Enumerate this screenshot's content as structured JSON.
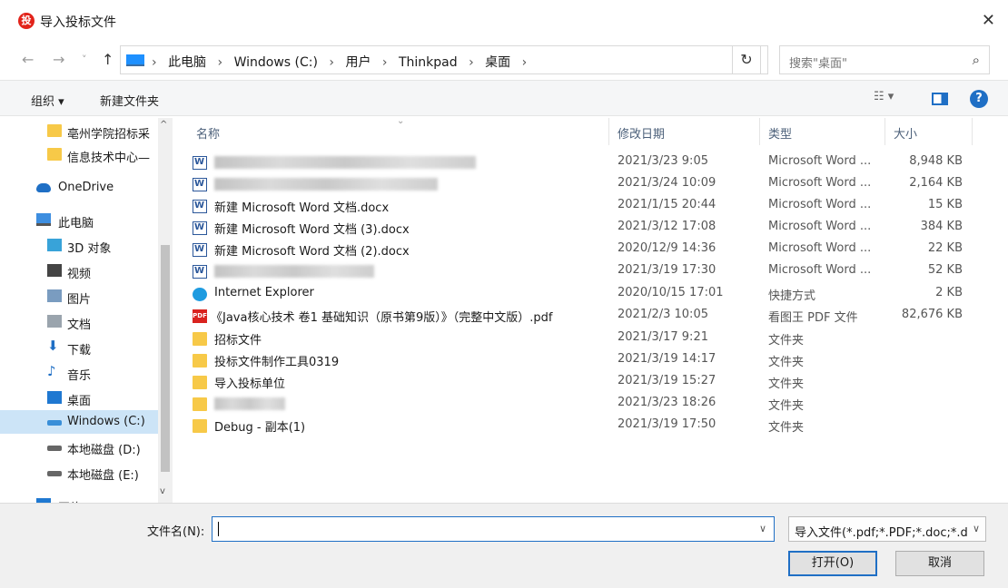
{
  "window": {
    "title": "导入投标文件",
    "app_icon": "app-logo-icon",
    "close": "✕"
  },
  "nav": {
    "back": "←",
    "forward": "→",
    "recent": "˅",
    "up": "↑",
    "breadcrumbs": [
      "此电脑",
      "Windows (C:)",
      "用户",
      "Thinkpad",
      "桌面"
    ],
    "separator": "›",
    "refresh": "↻",
    "search_placeholder": "搜索\"桌面\"",
    "search_icon": "⌕"
  },
  "toolbar": {
    "organize": "组织 ▾",
    "new_folder": "新建文件夹",
    "help": "?"
  },
  "sidebar": {
    "items": [
      {
        "label": "亳州学院招标采",
        "icon": "folder-icon"
      },
      {
        "label": "信息技术中心—",
        "icon": "folder-icon"
      },
      {
        "label": "OneDrive",
        "icon": "cloud-icon"
      },
      {
        "label": "此电脑",
        "icon": "computer-icon"
      },
      {
        "label": "3D 对象",
        "icon": "cube-icon"
      },
      {
        "label": "视频",
        "icon": "video-icon"
      },
      {
        "label": "图片",
        "icon": "pictures-icon"
      },
      {
        "label": "文档",
        "icon": "documents-icon"
      },
      {
        "label": "下载",
        "icon": "download-icon"
      },
      {
        "label": "音乐",
        "icon": "music-icon"
      },
      {
        "label": "桌面",
        "icon": "desktop-icon"
      },
      {
        "label": "Windows (C:)",
        "icon": "drive-icon"
      },
      {
        "label": "本地磁盘 (D:)",
        "icon": "drive-icon"
      },
      {
        "label": "本地磁盘 (E:)",
        "icon": "drive-icon"
      },
      {
        "label": "网络",
        "icon": "network-icon"
      }
    ],
    "selected": "Windows (C:)"
  },
  "columns": {
    "name": "名称",
    "date": "修改日期",
    "type": "类型",
    "size": "大小"
  },
  "files": [
    {
      "name": "",
      "date": "2021/3/23 9:05",
      "type": "Microsoft Word ...",
      "size": "8,948 KB",
      "icon": "word-doc-icon"
    },
    {
      "name": "",
      "date": "2021/3/24 10:09",
      "type": "Microsoft Word ...",
      "size": "2,164 KB",
      "icon": "word-doc-icon"
    },
    {
      "name": "新建 Microsoft Word 文档.docx",
      "date": "2021/1/15 20:44",
      "type": "Microsoft Word ...",
      "size": "15 KB",
      "icon": "word-doc-icon"
    },
    {
      "name": "新建 Microsoft Word 文档 (3).docx",
      "date": "2021/3/12 17:08",
      "type": "Microsoft Word ...",
      "size": "384 KB",
      "icon": "word-doc-icon"
    },
    {
      "name": "新建 Microsoft Word 文档 (2).docx",
      "date": "2020/12/9 14:36",
      "type": "Microsoft Word ...",
      "size": "22 KB",
      "icon": "word-doc-icon"
    },
    {
      "name": "",
      "date": "2021/3/19 17:30",
      "type": "Microsoft Word ...",
      "size": "52 KB",
      "icon": "word-doc-icon"
    },
    {
      "name": "Internet  Explorer",
      "date": "2020/10/15 17:01",
      "type": "快捷方式",
      "size": "2 KB",
      "icon": "internet-explorer-icon"
    },
    {
      "name": "《Java核心技术 卷1 基础知识（原书第9版）》（完整中文版）.pdf",
      "date": "2021/2/3 10:05",
      "type": "看图王 PDF 文件",
      "size": "82,676 KB",
      "icon": "pdf-icon"
    },
    {
      "name": "招标文件",
      "date": "2021/3/17 9:21",
      "type": "文件夹",
      "size": "",
      "icon": "folder-icon"
    },
    {
      "name": "投标文件制作工具0319",
      "date": "2021/3/19 14:17",
      "type": "文件夹",
      "size": "",
      "icon": "folder-icon"
    },
    {
      "name": "导入投标单位",
      "date": "2021/3/19 15:27",
      "type": "文件夹",
      "size": "",
      "icon": "folder-icon"
    },
    {
      "name": "",
      "date": "2021/3/23 18:26",
      "type": "文件夹",
      "size": "",
      "icon": "folder-icon"
    },
    {
      "name": "Debug - 副本(1)",
      "date": "2021/3/19 17:50",
      "type": "文件夹",
      "size": "",
      "icon": "folder-icon"
    }
  ],
  "footer": {
    "filename_label": "文件名(N):",
    "filename_value": "",
    "filter": "导入文件(*.pdf;*.PDF;*.doc;*.d",
    "open": "打开(O)",
    "cancel": "取消"
  },
  "colors": {
    "accent": "#1f6fc5",
    "selected_bg": "#cce4f7",
    "folder": "#f7c948"
  }
}
